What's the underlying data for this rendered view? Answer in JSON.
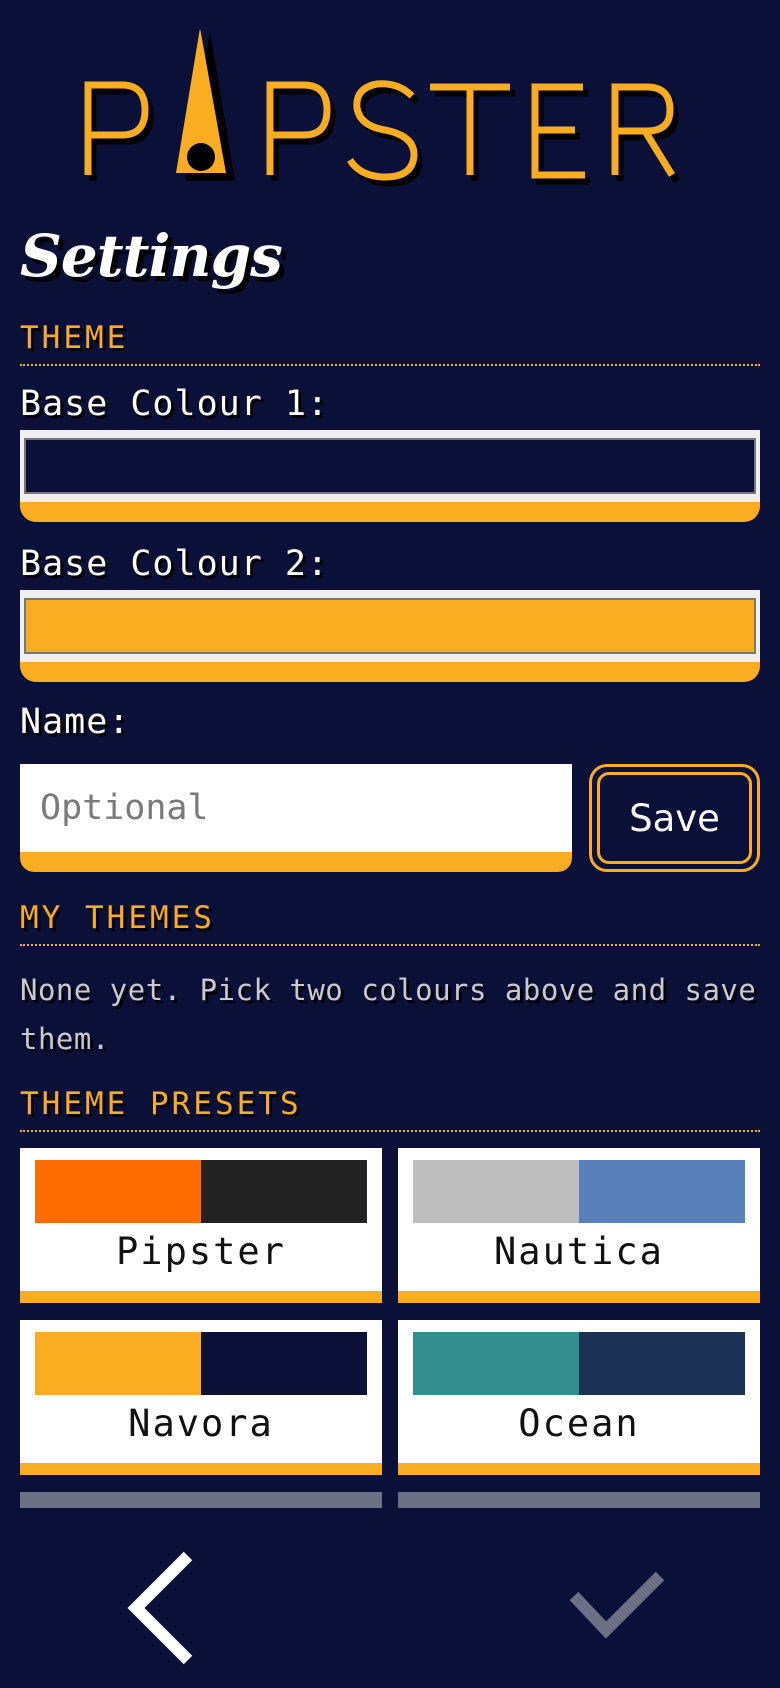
{
  "app": {
    "logo_text": "PIPSTER"
  },
  "page": {
    "title": "Settings"
  },
  "theme_section": {
    "heading": "THEME",
    "base_colour_1": {
      "label": "Base Colour 1:",
      "value": "#0b1038"
    },
    "base_colour_2": {
      "label": "Base Colour 2:",
      "value": "#fbad22"
    },
    "name": {
      "label": "Name:",
      "placeholder": "Optional",
      "value": ""
    },
    "save_label": "Save"
  },
  "my_themes": {
    "heading": "MY THEMES",
    "empty_text": "None yet. Pick two colours above and save them."
  },
  "presets": {
    "heading": "THEME PRESETS",
    "items": [
      {
        "name": "Pipster",
        "colors": [
          "#ff6d00",
          "#222222"
        ]
      },
      {
        "name": "Nautica",
        "colors": [
          "#bebebe",
          "#5a80bb"
        ]
      },
      {
        "name": "Navora",
        "colors": [
          "#fbad22",
          "#0b1038"
        ]
      },
      {
        "name": "Ocean",
        "colors": [
          "#338f8f",
          "#1c3156"
        ]
      }
    ]
  },
  "navigation": {
    "back_icon": "chevron-left-icon",
    "confirm_icon": "check-icon"
  },
  "colors": {
    "background": "#0b1038",
    "accent": "#fbad22",
    "text": "#ffffff"
  }
}
